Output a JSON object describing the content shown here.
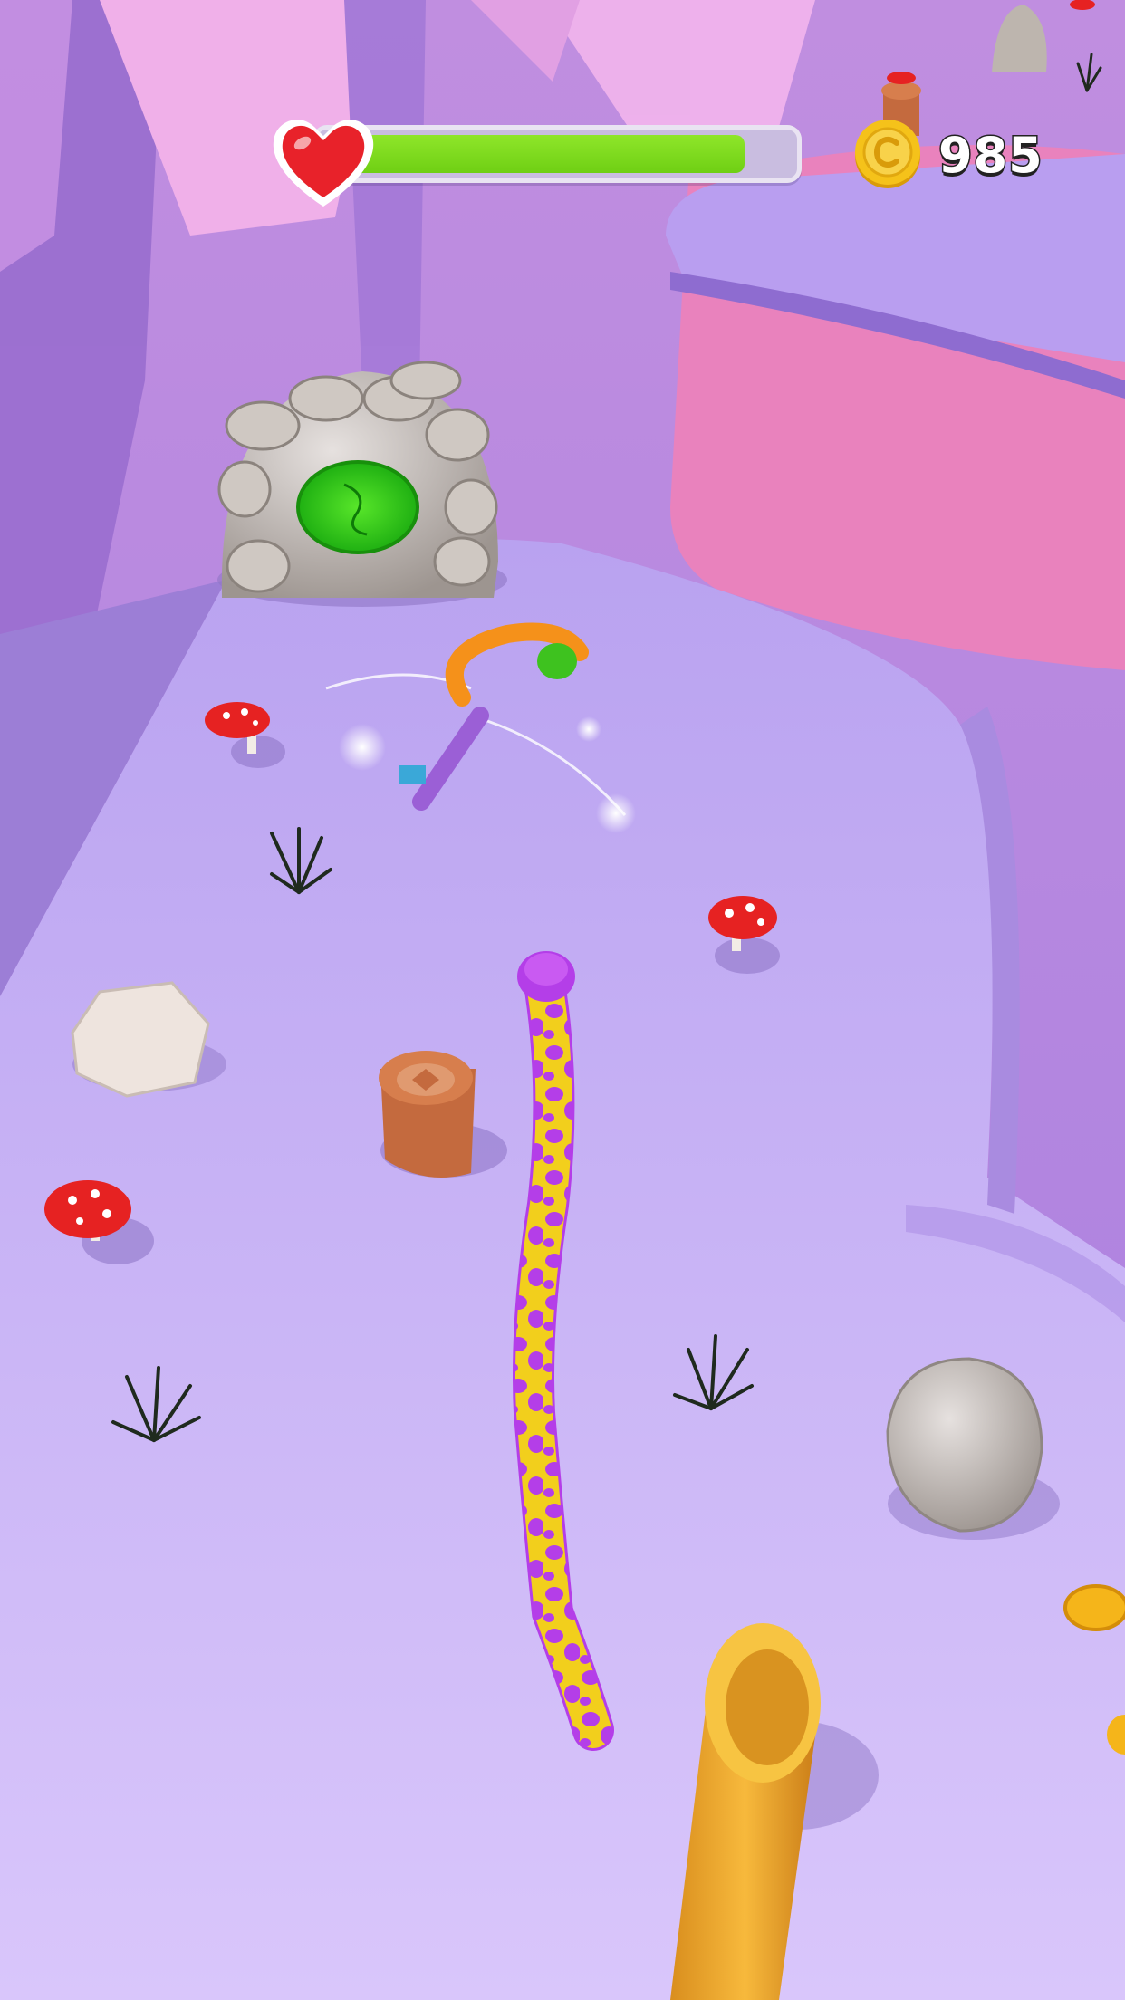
{
  "hud": {
    "health_fraction": 0.9,
    "coins": "985",
    "heart_color": "#e8222a",
    "health_color": "#7bd81a",
    "coin_color": "#f5c21a"
  },
  "icons": {
    "heart": "heart-icon",
    "coin": "coin-icon"
  },
  "palette": {
    "ground": "#c6b0f5",
    "cliff": "#e67fbb",
    "snake_base": "#f2cf1c",
    "snake_spots": "#b43ee8"
  }
}
